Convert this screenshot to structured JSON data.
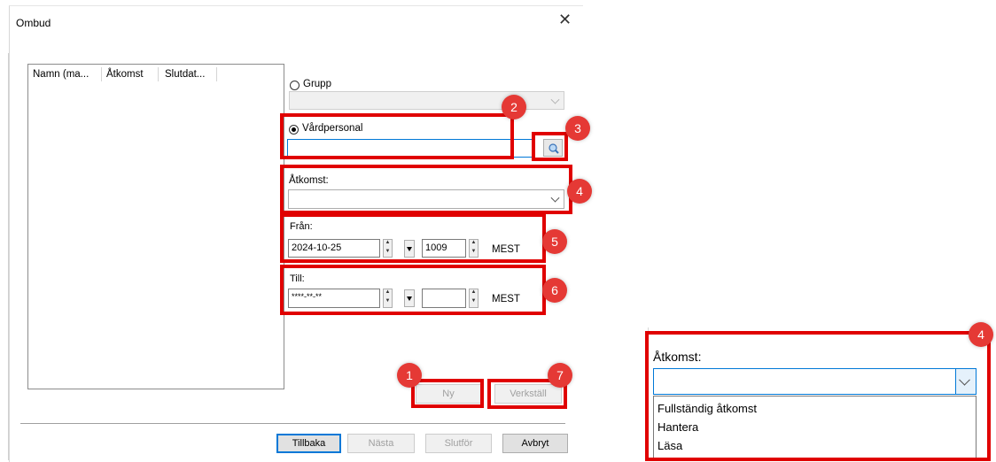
{
  "dialog": {
    "title": "Ombud",
    "close_glyph": "✕"
  },
  "list": {
    "columns": [
      "Namn (ma...",
      "Åtkomst",
      "Slutdat..."
    ]
  },
  "form": {
    "group_label": "Grupp",
    "staff_label": "Vårdpersonal",
    "staff_value": "",
    "access_label": "Åtkomst:",
    "from_label": "Från:",
    "from_date": "2024-10-25",
    "from_time": "1009",
    "from_tz": "MEST",
    "to_label": "Till:",
    "to_date": "****-**-**",
    "to_time": "",
    "to_tz": "MEST"
  },
  "actions": {
    "new_label": "Ny",
    "apply_label": "Verkställ"
  },
  "footer": {
    "back_label": "Tillbaka",
    "next_label": "Nästa",
    "finish_label": "Slutför",
    "cancel_label": "Avbryt"
  },
  "badges": {
    "b1": "1",
    "b2": "2",
    "b3": "3",
    "b4": "4",
    "b5": "5",
    "b6": "6",
    "b7": "7",
    "b4b": "4"
  },
  "zoom": {
    "access_label": "Åtkomst:",
    "options": [
      "Fullständig åtkomst",
      "Hantera",
      "Läsa"
    ]
  },
  "colors": {
    "annotation_red": "#e00000",
    "badge_red": "#e53935",
    "focus_blue": "#0078d7"
  }
}
